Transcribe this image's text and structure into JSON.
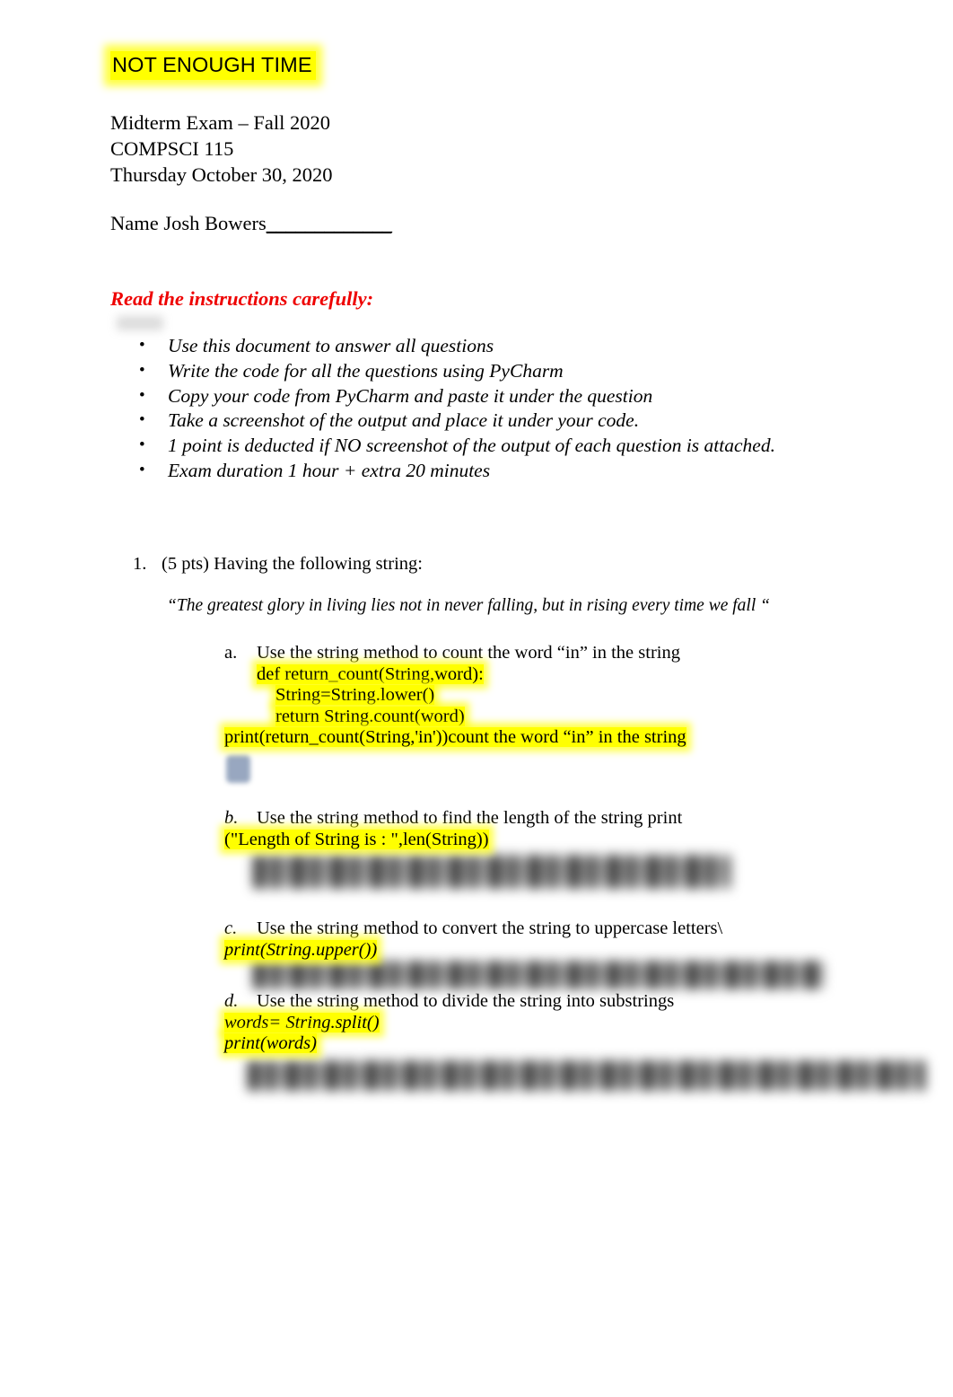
{
  "document": {
    "title": "NOT ENOUGH TIME",
    "header_lines": [
      "Midterm Exam – Fall 2020",
      "COMPSCI 115",
      "Thursday October 30, 2020"
    ],
    "name_label": "Name Josh Bowers",
    "name_blank": "_____________",
    "instructions_heading": "Read the instructions carefully:",
    "instructions": [
      "Use this document to answer all questions",
      "Write the code for all the questions using PyCharm",
      "Copy your code from PyCharm and paste it under the question",
      "Take a screenshot of the output and place it under your code.",
      "1 point is deducted if NO screenshot of the output of each question is attached.",
      "Exam duration 1 hour + extra 20 minutes"
    ],
    "questions": [
      {
        "number": "1.",
        "points": "(5 pts)",
        "prompt": "(5 pts) Having the following string:",
        "quote": "“The greatest glory in living lies not in never falling, but in rising every time we fall “",
        "parts": [
          {
            "letter": "a.",
            "prompt": "Use the string method to count the word “in” in the string",
            "code": [
              "def return_count(String,word):",
              "String=String.lower()",
              "return String.count(word)",
              "print(return_count(String,'in'))count the word “in” in the string"
            ]
          },
          {
            "letter": "b.",
            "prompt": "Use the string method to find the length of the string print",
            "code": [
              "(\"Length of String is : \",len(String))"
            ]
          },
          {
            "letter": "c.",
            "prompt": "Use the string method to convert the string to uppercase letters\\",
            "code": [
              "print(String.upper())"
            ]
          },
          {
            "letter": "d.",
            "prompt": "Use the string method to divide the string into substrings",
            "code": [
              "words= String.split()",
              "print(words)"
            ]
          }
        ]
      }
    ]
  },
  "colors": {
    "highlight": "#ffff00",
    "heading_red": "#ee0000",
    "text": "#000000",
    "artifact_blue": "#93a3bd"
  }
}
